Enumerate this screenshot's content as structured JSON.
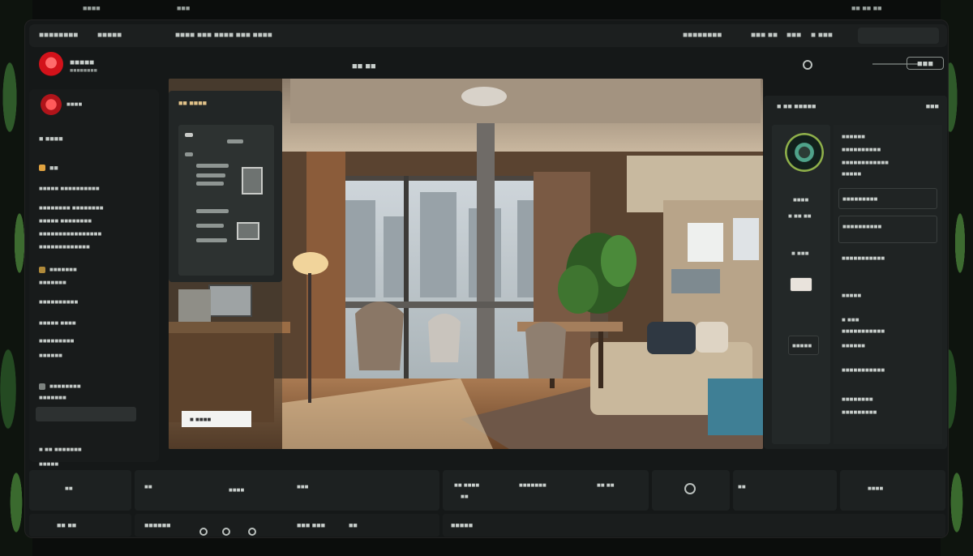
{
  "top_strip": {
    "left_text": "■■■■",
    "center_text": "■■■",
    "right_text": "■■ ■■ ■■"
  },
  "titlebar": {
    "app_name": "■■■■■■■■",
    "menu_item": "■■■■■",
    "document_title": "■■■■ ■■■  ■■■■ ■■■ ■■■■",
    "nav_items": [
      "■■■■■■■■",
      "■■■ ■■",
      "■■■",
      "■ ■■■"
    ]
  },
  "header": {
    "brand_title": "■■■■■",
    "brand_subtitle": "■■■■■■■■",
    "center_label": "■■ ■■",
    "action_label": "■■■"
  },
  "sidebar": {
    "profile_label": "■■■■",
    "section_label": "■ ■■■■",
    "group_label": "■■",
    "items": [
      "■■■■■ ■■■■■■■■■■",
      "■■■■■■■■ ■■■■■■■■",
      "■■■■■ ■■■■■■■■",
      "■■■■■■■■■■■■■■■■",
      "■■■■■■■■■■■■■",
      "■■■■■■■",
      "■■■■■■■",
      "■■■■■■■■■■",
      "■■■■■ ■■■■",
      "■■■■■■■■■",
      "■■■■■■",
      "■■■■■■■■",
      "■■■■■■■",
      "■ ■■ ■■■■■■■",
      "■■■■■"
    ]
  },
  "left_panel": {
    "title": "■■ ■■■■",
    "section_title": "■■■■■■■■■■■■ ■■■"
  },
  "viewer": {
    "caption": "■ ■■■■",
    "top_label": "■■■■■■■■"
  },
  "right_panel": {
    "header_left": "■ ■■ ■■■■■",
    "header_right": "■■■",
    "col1": [
      "■■■■",
      "■ ■■ ■■",
      "■ ■■■",
      "■■■■■"
    ],
    "col2": [
      "■■■■■■",
      "■■■■■■■■■■",
      "■■■■■■■■■■■■",
      "■■■■■",
      "■■■■■■■■■",
      "■■■■■■■■■■",
      "■■■■■■■■■■■",
      "■■■■■",
      "■ ■■■",
      "■■■■■■■■■■■",
      "■■■■■■",
      "■■■■■■■■■■■",
      "■■■■■■■■",
      "■■■■■■■■■"
    ]
  },
  "bottom_bar": {
    "labels": [
      "■■",
      "■■",
      "■■■■",
      "■■■",
      "■■ ■■■■",
      "■■",
      "■■■■■■■",
      "■■ ■■",
      "■■",
      "■■■■"
    ]
  },
  "status_bar": {
    "labels": [
      "■■ ■■",
      "■■■■■■",
      "■■■ ■■■",
      "■■",
      "■■■■■"
    ]
  }
}
